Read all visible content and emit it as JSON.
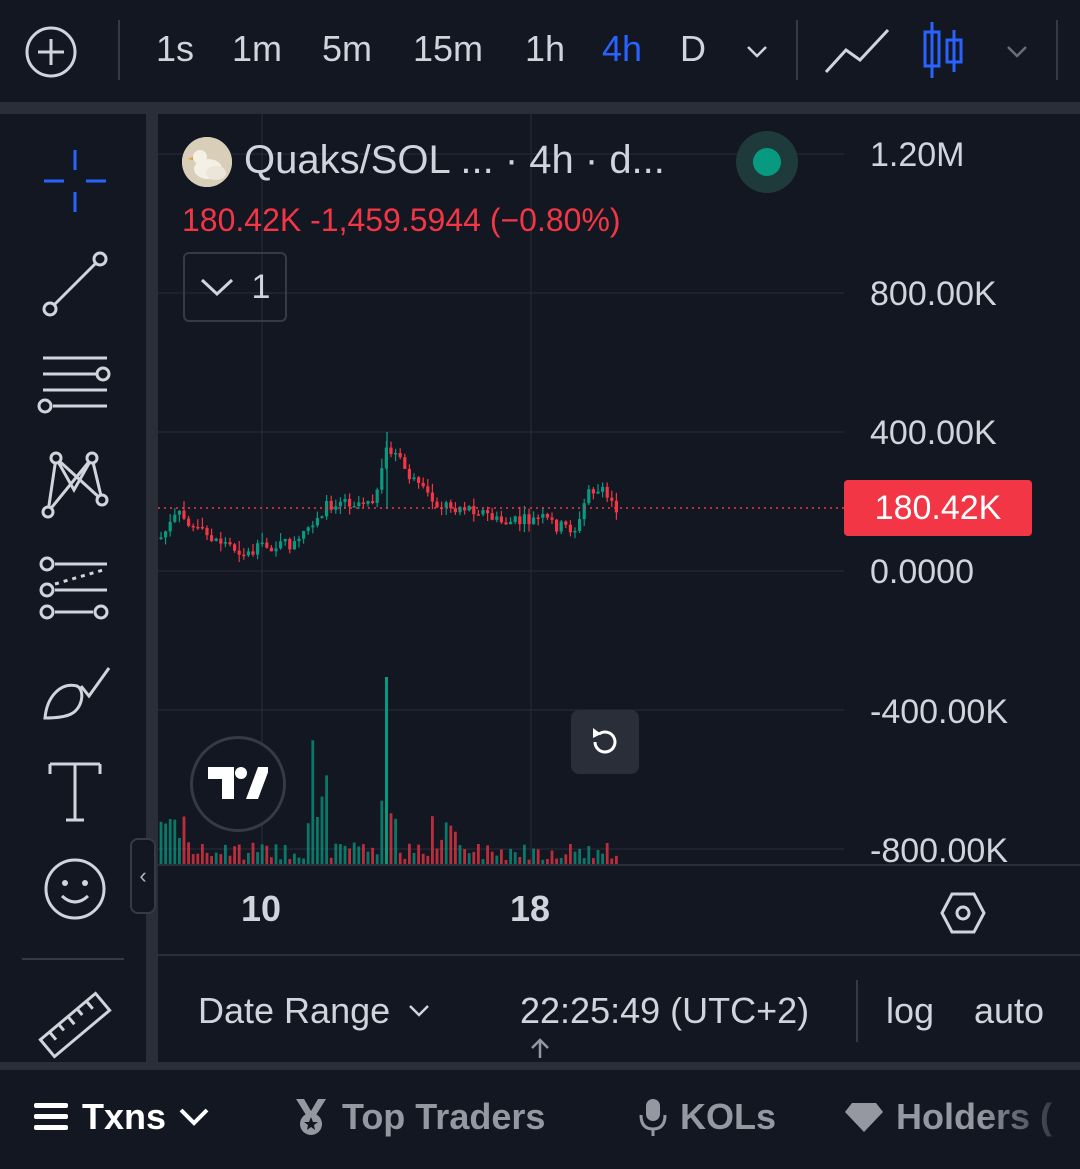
{
  "timeframes": [
    {
      "label": "1s",
      "active": false
    },
    {
      "label": "1m",
      "active": false
    },
    {
      "label": "5m",
      "active": false
    },
    {
      "label": "15m",
      "active": false
    },
    {
      "label": "1h",
      "active": false
    },
    {
      "label": "4h",
      "active": true
    },
    {
      "label": "D",
      "active": false
    }
  ],
  "icons": {
    "add": "plus-circle-icon",
    "more_timeframes": "chevron-down-icon",
    "line_chart": "line-chart-icon",
    "candles": "candlestick-icon",
    "chart_type_menu": "chevron-down-icon"
  },
  "drawing_tools": [
    "crosshair-icon",
    "trend-line-icon",
    "horizontal-lines-icon",
    "pattern-icon",
    "fib-icon",
    "brush-icon",
    "text-icon",
    "emoji-icon",
    "ruler-icon"
  ],
  "legend": {
    "title": "Quaks/SOL ... · 4h · d...",
    "values": "180.42K  -1,459.5944 (−0.80%)",
    "series_count": "1"
  },
  "price_axis": {
    "labels": [
      "1.20M",
      "800.00K",
      "400.00K",
      "0.0000",
      "-400.00K",
      "-800.00K"
    ],
    "current_price": "180.42K"
  },
  "time_axis": {
    "labels": [
      "10",
      "18"
    ]
  },
  "bottom_controls": {
    "date_range": "Date Range",
    "clock": "22:25:49 (UTC+2)",
    "log": "log",
    "auto": "auto"
  },
  "bottom_tabs": [
    {
      "label": "Txns"
    },
    {
      "label": "Top Traders"
    },
    {
      "label": "KOLs"
    },
    {
      "label": "Holders ("
    }
  ],
  "colors": {
    "background": "#131722",
    "up": "#089981",
    "down": "#f23645",
    "accent": "#2962ff"
  }
}
